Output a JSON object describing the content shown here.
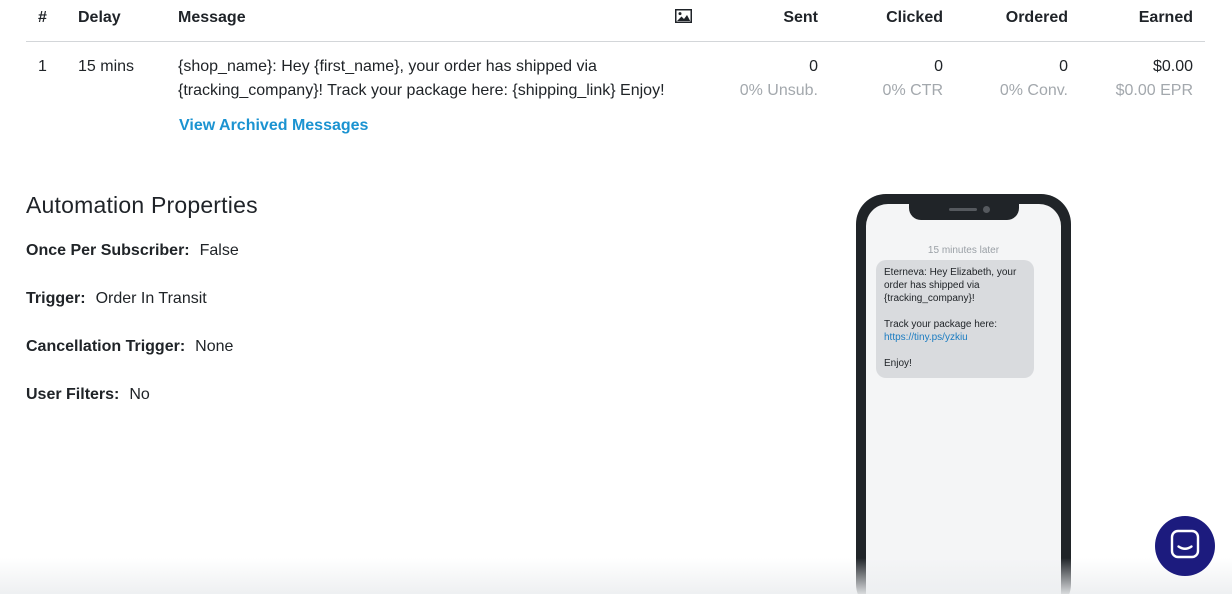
{
  "table": {
    "headers": {
      "num": "#",
      "delay": "Delay",
      "message": "Message",
      "image_icon": "image-icon",
      "sent": "Sent",
      "clicked": "Clicked",
      "ordered": "Ordered",
      "earned": "Earned"
    },
    "rows": [
      {
        "num": "1",
        "delay": "15 mins",
        "message": "{shop_name}: Hey {first_name}, your order has shipped via {tracking_company}! Track your package here: {shipping_link} Enjoy!",
        "sent": "0",
        "sent_sub": "0% Unsub.",
        "clicked": "0",
        "clicked_sub": "0% CTR",
        "ordered": "0",
        "ordered_sub": "0% Conv.",
        "earned": "$0.00",
        "earned_sub": "$0.00 EPR"
      }
    ],
    "archived_link": "View Archived Messages"
  },
  "properties": {
    "title": "Automation Properties",
    "items": [
      {
        "key": "Once Per Subscriber:",
        "value": "False"
      },
      {
        "key": "Trigger:",
        "value": "Order In Transit"
      },
      {
        "key": "Cancellation Trigger:",
        "value": "None"
      },
      {
        "key": "User Filters:",
        "value": "No"
      }
    ]
  },
  "phone_preview": {
    "time_label": "15 minutes later",
    "bubble": {
      "line1": "Eterneva: Hey Elizabeth, your order has shipped via {tracking_company}!",
      "line2": "Track your package here:",
      "link": "https://tiny.ps/yzkiu",
      "line3": "Enjoy!"
    }
  },
  "chat": {
    "icon": "chat-icon"
  },
  "colors": {
    "link": "#1b93d1",
    "muted": "#a3a8ad",
    "chat_button": "#1c1b7e",
    "phone_frame": "#202428"
  }
}
